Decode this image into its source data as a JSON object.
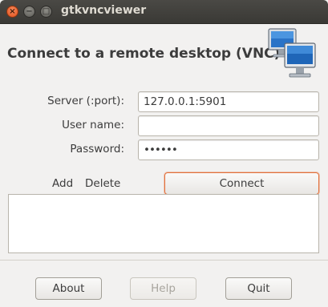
{
  "window": {
    "title": "gtkvncviewer",
    "controls": {
      "close": "×",
      "minimize": "−",
      "maximize": "□"
    }
  },
  "header": {
    "title": "Connect to a remote desktop (VNC)",
    "icon": "computers-network-icon"
  },
  "form": {
    "server": {
      "label": "Server (:port):",
      "value": "127.0.0.1:5901"
    },
    "username": {
      "label": "User name:",
      "value": ""
    },
    "password": {
      "label": "Password:",
      "value": "••••••"
    }
  },
  "actions": {
    "add": "Add",
    "delete": "Delete",
    "connect": "Connect"
  },
  "saved_connections": [],
  "footer": {
    "about": "About",
    "help": "Help",
    "quit": "Quit"
  },
  "colors": {
    "titlebar": "#3c3b37",
    "close_button": "#e95420",
    "focus_ring": "#e2703b",
    "window_bg": "#f2f1f0"
  }
}
